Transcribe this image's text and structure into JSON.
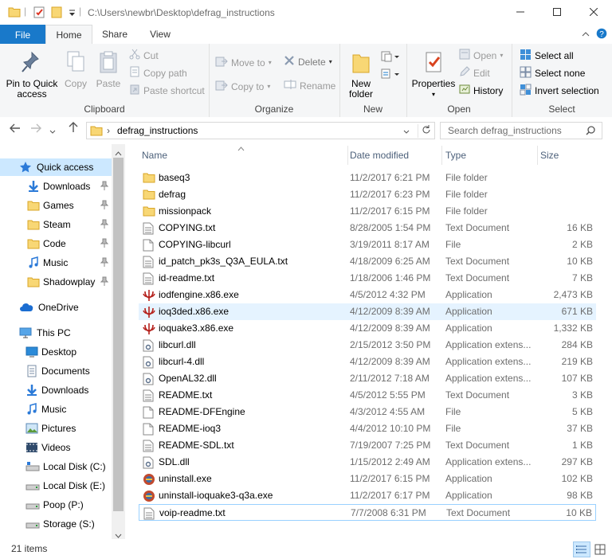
{
  "window": {
    "title": "C:\\Users\\newbr\\Desktop\\defrag_instructions"
  },
  "tabs": {
    "file": "File",
    "home": "Home",
    "share": "Share",
    "view": "View"
  },
  "ribbon": {
    "clipboard": {
      "label": "Clipboard",
      "pin": "Pin to Quick access",
      "copy": "Copy",
      "paste": "Paste",
      "cut": "Cut",
      "copy_path": "Copy path",
      "paste_shortcut": "Paste shortcut"
    },
    "organize": {
      "label": "Organize",
      "move_to": "Move to",
      "copy_to": "Copy to",
      "delete": "Delete",
      "rename": "Rename"
    },
    "new": {
      "label": "New",
      "new_folder": "New folder"
    },
    "open": {
      "label": "Open",
      "properties": "Properties",
      "open": "Open",
      "edit": "Edit",
      "history": "History"
    },
    "select": {
      "label": "Select",
      "select_all": "Select all",
      "select_none": "Select none",
      "invert": "Invert selection"
    }
  },
  "address": {
    "path": "defrag_instructions",
    "search_placeholder": "Search defrag_instructions"
  },
  "nav": {
    "quick_access": "Quick access",
    "quick": [
      {
        "label": "Downloads",
        "icon": "downloads-icon",
        "pinned": true
      },
      {
        "label": "Games",
        "icon": "folder-icon",
        "pinned": true
      },
      {
        "label": "Steam",
        "icon": "folder-icon",
        "pinned": true
      },
      {
        "label": "Code",
        "icon": "folder-icon",
        "pinned": true
      },
      {
        "label": "Music",
        "icon": "music-icon",
        "pinned": true
      },
      {
        "label": "Shadowplay",
        "icon": "folder-icon",
        "pinned": true
      }
    ],
    "onedrive": "OneDrive",
    "this_pc": "This PC",
    "pc": [
      {
        "label": "Desktop",
        "icon": "desktop-icon"
      },
      {
        "label": "Documents",
        "icon": "documents-icon"
      },
      {
        "label": "Downloads",
        "icon": "downloads-icon"
      },
      {
        "label": "Music",
        "icon": "music-icon"
      },
      {
        "label": "Pictures",
        "icon": "pictures-icon"
      },
      {
        "label": "Videos",
        "icon": "videos-icon"
      },
      {
        "label": "Local Disk (C:)",
        "icon": "windows-drive-icon"
      },
      {
        "label": "Local Disk (E:)",
        "icon": "drive-icon"
      },
      {
        "label": "Poop (P:)",
        "icon": "drive-icon"
      },
      {
        "label": "Storage (S:)",
        "icon": "drive-icon"
      }
    ]
  },
  "columns": {
    "name": "Name",
    "date": "Date modified",
    "type": "Type",
    "size": "Size"
  },
  "files": [
    {
      "name": "baseq3",
      "date": "11/2/2017 6:21 PM",
      "type": "File folder",
      "size": "",
      "icon": "folder-icon"
    },
    {
      "name": "defrag",
      "date": "11/2/2017 6:23 PM",
      "type": "File folder",
      "size": "",
      "icon": "folder-icon"
    },
    {
      "name": "missionpack",
      "date": "11/2/2017 6:15 PM",
      "type": "File folder",
      "size": "",
      "icon": "folder-icon"
    },
    {
      "name": "COPYING.txt",
      "date": "8/28/2005 1:54 PM",
      "type": "Text Document",
      "size": "16 KB",
      "icon": "text-file-icon"
    },
    {
      "name": "COPYING-libcurl",
      "date": "3/19/2011 8:17 AM",
      "type": "File",
      "size": "2 KB",
      "icon": "file-icon"
    },
    {
      "name": "id_patch_pk3s_Q3A_EULA.txt",
      "date": "4/18/2009 6:25 AM",
      "type": "Text Document",
      "size": "10 KB",
      "icon": "text-file-icon"
    },
    {
      "name": "id-readme.txt",
      "date": "1/18/2006 1:46 PM",
      "type": "Text Document",
      "size": "7 KB",
      "icon": "text-file-icon"
    },
    {
      "name": "iodfengine.x86.exe",
      "date": "4/5/2012 4:32 PM",
      "type": "Application",
      "size": "2,473 KB",
      "icon": "quake-icon"
    },
    {
      "name": "ioq3ded.x86.exe",
      "date": "4/12/2009 8:39 AM",
      "type": "Application",
      "size": "671 KB",
      "icon": "quake-icon"
    },
    {
      "name": "ioquake3.x86.exe",
      "date": "4/12/2009 8:39 AM",
      "type": "Application",
      "size": "1,332 KB",
      "icon": "quake-icon"
    },
    {
      "name": "libcurl.dll",
      "date": "2/15/2012 3:50 PM",
      "type": "Application extens...",
      "size": "284 KB",
      "icon": "dll-icon"
    },
    {
      "name": "libcurl-4.dll",
      "date": "4/12/2009 8:39 AM",
      "type": "Application extens...",
      "size": "219 KB",
      "icon": "dll-icon"
    },
    {
      "name": "OpenAL32.dll",
      "date": "2/11/2012 7:18 AM",
      "type": "Application extens...",
      "size": "107 KB",
      "icon": "dll-icon"
    },
    {
      "name": "README.txt",
      "date": "4/5/2012 5:55 PM",
      "type": "Text Document",
      "size": "3 KB",
      "icon": "text-file-icon"
    },
    {
      "name": "README-DFEngine",
      "date": "4/3/2012 4:55 AM",
      "type": "File",
      "size": "5 KB",
      "icon": "file-icon"
    },
    {
      "name": "README-ioq3",
      "date": "4/4/2012 10:10 PM",
      "type": "File",
      "size": "37 KB",
      "icon": "file-icon"
    },
    {
      "name": "README-SDL.txt",
      "date": "7/19/2007 7:25 PM",
      "type": "Text Document",
      "size": "1 KB",
      "icon": "text-file-icon"
    },
    {
      "name": "SDL.dll",
      "date": "1/15/2012 2:49 AM",
      "type": "Application extens...",
      "size": "297 KB",
      "icon": "dll-icon"
    },
    {
      "name": "uninstall.exe",
      "date": "11/2/2017 6:15 PM",
      "type": "Application",
      "size": "102 KB",
      "icon": "installer-icon"
    },
    {
      "name": "uninstall-ioquake3-q3a.exe",
      "date": "11/2/2017 6:17 PM",
      "type": "Application",
      "size": "98 KB",
      "icon": "installer-icon"
    },
    {
      "name": "voip-readme.txt",
      "date": "7/7/2008 6:31 PM",
      "type": "Text Document",
      "size": "10 KB",
      "icon": "text-file-icon"
    }
  ],
  "status": {
    "items": "21 items"
  },
  "colors": {
    "accent": "#1979ca",
    "selection": "#cce8ff",
    "hover": "#e5f3ff",
    "folder": "#f8d775"
  }
}
